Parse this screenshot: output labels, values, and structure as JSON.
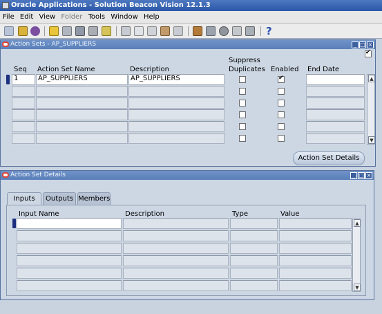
{
  "app": {
    "title": "Oracle Applications - Solution Beacon Vision 12.1.3"
  },
  "menu": [
    {
      "label": "File",
      "enabled": true
    },
    {
      "label": "Edit",
      "enabled": true
    },
    {
      "label": "View",
      "enabled": true
    },
    {
      "label": "Folder",
      "enabled": false
    },
    {
      "label": "Tools",
      "enabled": true
    },
    {
      "label": "Window",
      "enabled": true
    },
    {
      "label": "Help",
      "enabled": true
    }
  ],
  "toolbar": {
    "help_glyph": "?"
  },
  "action_sets": {
    "title": "Action Sets - AP_SUPPLIERS",
    "headers": {
      "seq": "Seq",
      "name": "Action Set Name",
      "description": "Description",
      "suppress1": "Suppress",
      "suppress2": "Duplicates",
      "enabled": "Enabled",
      "end_date": "End Date"
    },
    "rows": [
      {
        "seq": "1",
        "name": "AP_SUPPLIERS",
        "description": "AP_SUPPLIERS",
        "suppress": false,
        "enabled": true,
        "end_date": ""
      },
      {
        "seq": "",
        "name": "",
        "description": "",
        "suppress": false,
        "enabled": false,
        "end_date": ""
      },
      {
        "seq": "",
        "name": "",
        "description": "",
        "suppress": false,
        "enabled": false,
        "end_date": ""
      },
      {
        "seq": "",
        "name": "",
        "description": "",
        "suppress": false,
        "enabled": false,
        "end_date": ""
      },
      {
        "seq": "",
        "name": "",
        "description": "",
        "suppress": false,
        "enabled": false,
        "end_date": ""
      },
      {
        "seq": "",
        "name": "",
        "description": "",
        "suppress": false,
        "enabled": false,
        "end_date": ""
      }
    ],
    "details_button": "Action Set Details"
  },
  "action_set_details": {
    "title": "Action Set Details",
    "tabs": [
      "Inputs",
      "Outputs",
      "Members"
    ],
    "active_tab": "Inputs",
    "headers": {
      "input_name": "Input Name",
      "description": "Description",
      "type": "Type",
      "value": "Value"
    }
  }
}
